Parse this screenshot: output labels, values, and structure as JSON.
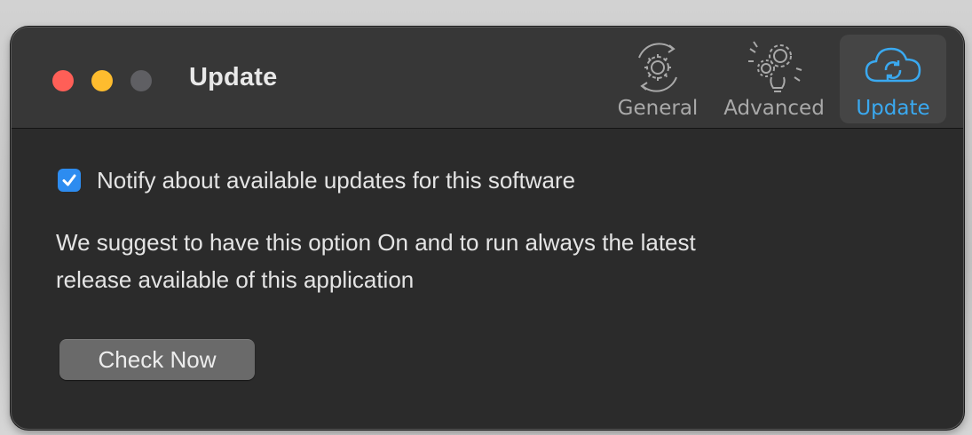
{
  "window": {
    "title": "Update"
  },
  "toolbar": {
    "items": [
      {
        "label": "General",
        "icon": "gear-refresh-icon",
        "selected": false
      },
      {
        "label": "Advanced",
        "icon": "gears-lightbulb-icon",
        "selected": false
      },
      {
        "label": "Update",
        "icon": "cloud-sync-icon",
        "selected": true
      }
    ]
  },
  "settings": {
    "notify_checkbox": {
      "label": "Notify about available updates for this software",
      "checked": true
    },
    "description_line1": "We suggest to have this option On and to run always the latest",
    "description_line2": "release available of this application",
    "check_button": "Check Now"
  },
  "colors": {
    "accent": "#3aa9f0",
    "checkbox": "#2d8cf0",
    "close": "#ff5f57",
    "minimize": "#febc2e",
    "zoom_disabled": "#5f5f63",
    "background": "#2b2b2b"
  }
}
